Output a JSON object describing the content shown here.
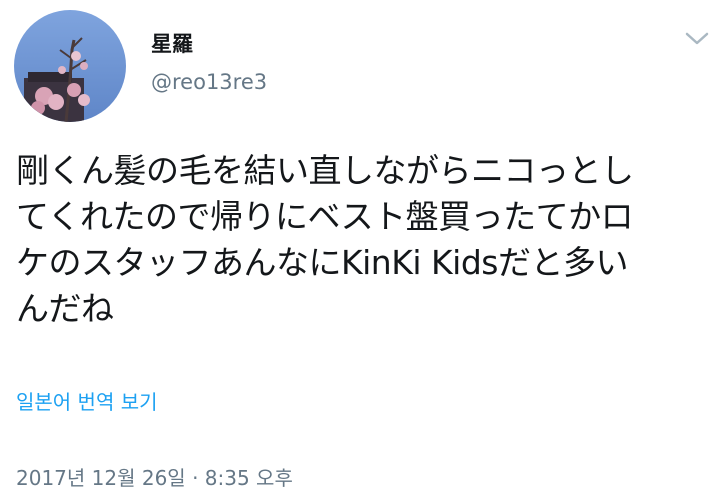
{
  "user": {
    "display_name": "星羅",
    "handle": "@reo13re3"
  },
  "tweet": {
    "text": "剛くん髪の毛を結い直しながらニコっとし\nてくれたので帰りにベスト盤買ったてかロ\nケのスタッフあんなにKinKi Kidsだと多い\nんだね",
    "translate_label": "일본어 번역 보기",
    "timestamp": "2017년 12월 26일 · 8:35 오후"
  },
  "icons": {
    "caret": "chevron-down-icon",
    "avatar": "avatar-image"
  },
  "colors": {
    "link": "#1da1f2",
    "muted": "#657786",
    "text": "#14171a"
  }
}
